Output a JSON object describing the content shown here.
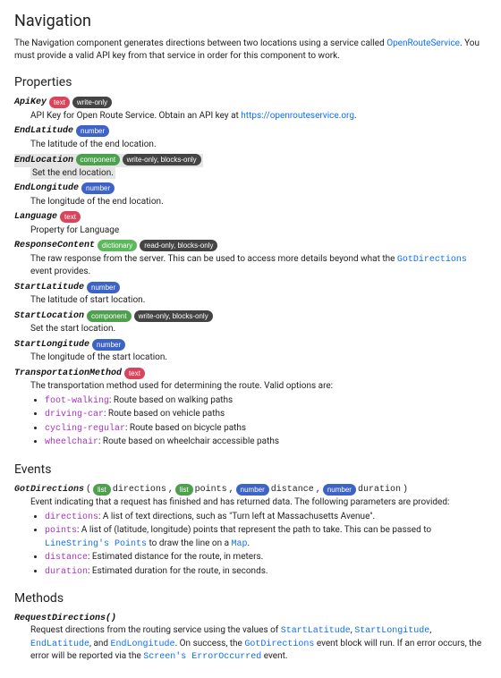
{
  "title": "Navigation",
  "intro_before_link": "The Navigation component generates directions between two locations using a service called ",
  "intro_link": "OpenRouteService",
  "intro_after_link": ". You must provide a valid API key from that service in order for this component to work.",
  "sections": {
    "properties": "Properties",
    "events": "Events",
    "methods": "Methods"
  },
  "badges": {
    "text": "text",
    "number": "number",
    "component": "component",
    "dictionary": "dictionary",
    "list": "list",
    "write_only": "write-only",
    "read_only_blocks_only": "read-only, blocks-only",
    "write_only_blocks_only": "write-only, blocks-only"
  },
  "props": {
    "apikey": {
      "name": "ApiKey",
      "desc_before_link": "API Key for Open Route Service. Obtain an API key at ",
      "link": "https://openrouteservice.org",
      "desc_after_link": "."
    },
    "endlat": {
      "name": "EndLatitude",
      "desc": "The latitude of the end location."
    },
    "endloc": {
      "name": "EndLocation",
      "desc": "Set the end location."
    },
    "endlon": {
      "name": "EndLongitude",
      "desc": "The longitude of the end location."
    },
    "lang": {
      "name": "Language",
      "desc": "Property for Language"
    },
    "resp": {
      "name": "ResponseContent",
      "desc_before": "The raw response from the server. This can be used to access more details beyond what the ",
      "code": "GotDirections",
      "desc_after": " event provides."
    },
    "startlat": {
      "name": "StartLatitude",
      "desc": "The latitude of start location."
    },
    "startloc": {
      "name": "StartLocation",
      "desc": "Set the start location."
    },
    "startlon": {
      "name": "StartLongitude",
      "desc": "The longitude of the start location."
    },
    "method": {
      "name": "TransportationMethod",
      "desc": "The transportation method used for determining the route. Valid options are:",
      "opts": [
        {
          "code": "foot-walking",
          "txt": ": Route based on walking paths"
        },
        {
          "code": "driving-car",
          "txt": ": Route based on vehicle paths"
        },
        {
          "code": "cycling-regular",
          "txt": ": Route based on bicycle paths"
        },
        {
          "code": "wheelchair",
          "txt": ": Route based on wheelchair accessible paths"
        }
      ]
    }
  },
  "events": {
    "got": {
      "name": "GotDirections",
      "open": "(",
      "p1": "directions",
      "c1": ",",
      "p2": "points",
      "c2": ",",
      "p3": "distance",
      "c3": ",",
      "p4": "duration",
      "close": ")",
      "desc": "Event indicating that a request has finished and has returned data. The following parameters are provided:",
      "items": [
        {
          "code": "directions",
          "txt": ": A list of text directions, such as \"Turn left at Massachusetts Avenue\"."
        },
        {
          "code": "points",
          "txt_before": ": A list of (latitude, longitude) points that represent the path to take. This can be passed to ",
          "link": "LineString's Points",
          "txt_after": " to draw the line on a ",
          "link2": "Map",
          "dot": "."
        },
        {
          "code": "distance",
          "txt": ": Estimated distance for the route, in meters."
        },
        {
          "code": "duration",
          "txt": ": Estimated duration for the route, in seconds."
        }
      ]
    }
  },
  "methods": {
    "req": {
      "name": "RequestDirections()",
      "before": "Request directions from the routing service using the values of ",
      "p1": "StartLatitude",
      "s1": ", ",
      "p2": "StartLongitude",
      "s2": ", ",
      "p3": "EndLatitude",
      "s3": ", and ",
      "p4": "EndLongitude",
      "mid": ". On success, the ",
      "p5": "GotDirections",
      "after1": " event block will run. If an error occurs, the error will be reported via the ",
      "link": "Screen's ErrorOccurred",
      "after2": " event."
    }
  }
}
